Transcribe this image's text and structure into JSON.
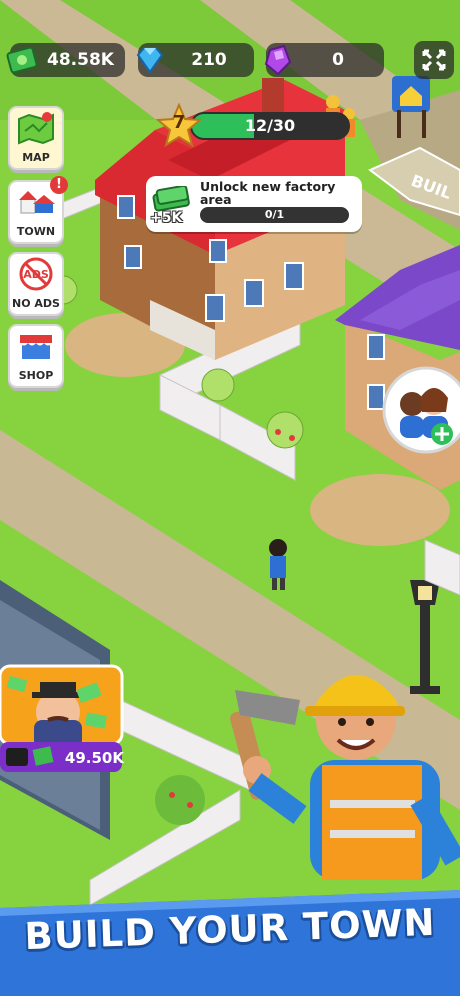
{
  "hud": {
    "cash": "48.58K",
    "gems": "210",
    "purple_gems": "0"
  },
  "side_menu": [
    {
      "label": "MAP",
      "icon": "map-icon"
    },
    {
      "label": "TOWN",
      "icon": "town-icon",
      "badge": "!"
    },
    {
      "label": "NO ADS",
      "icon": "no-ads-icon"
    },
    {
      "label": "SHOP",
      "icon": "shop-icon"
    }
  ],
  "level": {
    "number": "7",
    "progress_text": "12/30",
    "progress_fraction": 0.4
  },
  "quest": {
    "title": "Unlock new factory area",
    "progress_text": "0/1",
    "progress_fraction": 0,
    "reward": "+5K"
  },
  "manager_offer": {
    "price": "49.50K"
  },
  "scene": {
    "build_sign_text": "BUIL",
    "ads_icon_text": "ADS"
  },
  "banner": {
    "text": "BUILD YOUR TOWN"
  },
  "colors": {
    "grass": "#7fcf3a",
    "path": "#c9b894",
    "red_roof": "#e0303a",
    "purple_roof": "#7a48c8",
    "progress_green": "#2fbf5a",
    "banner_blue": "#2f74d8"
  }
}
